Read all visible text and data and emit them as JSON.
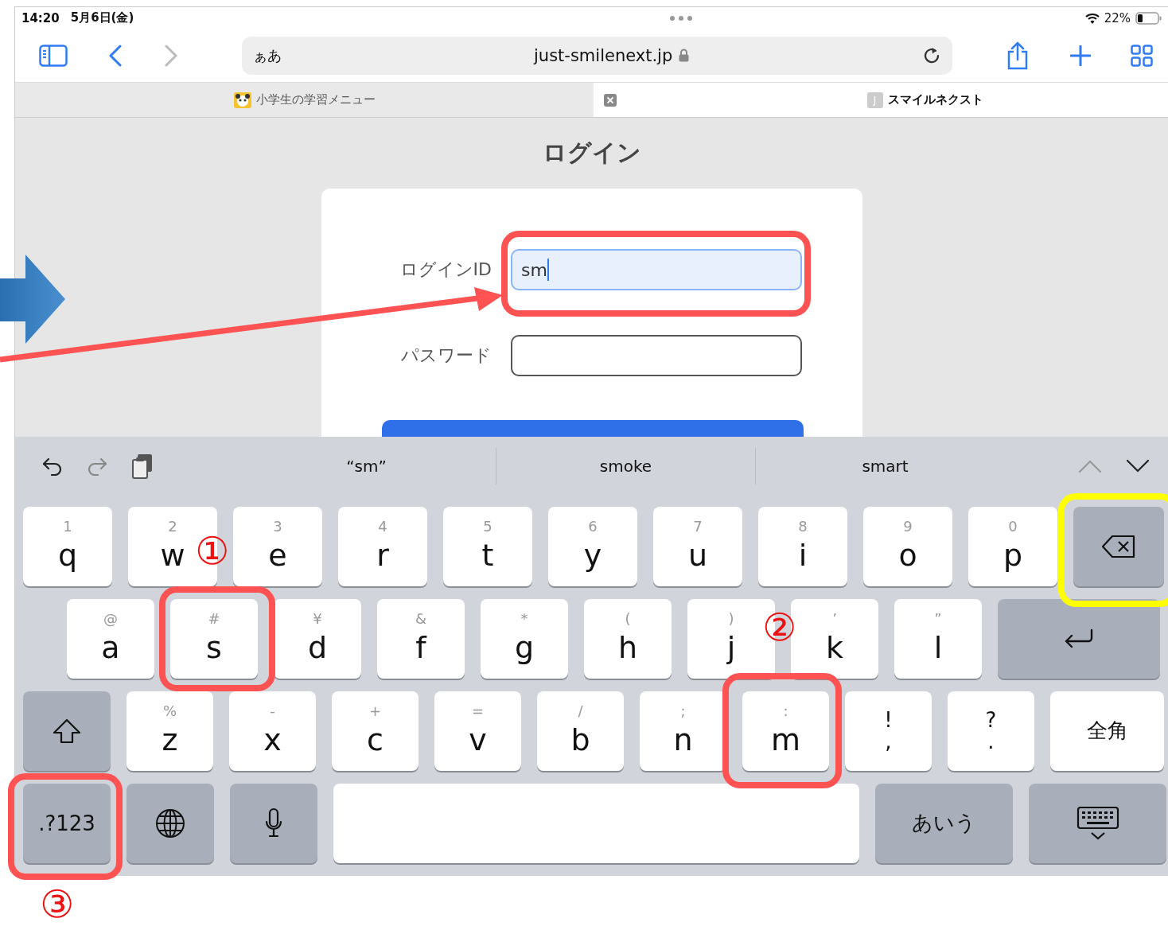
{
  "status_bar": {
    "time": "14:20",
    "date": "5月6日(金)",
    "battery": "22%"
  },
  "browser": {
    "format_button": "ぁあ",
    "url": "just-smilenext.jp",
    "tabs": [
      {
        "title": "小学生の学習メニュー",
        "selected": false
      },
      {
        "title": "スマイルネクスト",
        "favicon_letter": "J",
        "selected": true
      }
    ]
  },
  "page": {
    "heading": "ログイン",
    "fields": [
      {
        "label": "ログインID",
        "value": "sm",
        "focused": true
      },
      {
        "label": "パスワード",
        "focused": false
      }
    ]
  },
  "keyboard": {
    "suggestions": [
      "“sm”",
      "smoke",
      "smart"
    ],
    "rows": [
      [
        {
          "kind": "letter",
          "label": "q",
          "hint": "1"
        },
        {
          "kind": "letter",
          "label": "w",
          "hint": "2"
        },
        {
          "kind": "letter",
          "label": "e",
          "hint": "3"
        },
        {
          "kind": "letter",
          "label": "r",
          "hint": "4"
        },
        {
          "kind": "letter",
          "label": "t",
          "hint": "5"
        },
        {
          "kind": "letter",
          "label": "y",
          "hint": "6"
        },
        {
          "kind": "letter",
          "label": "u",
          "hint": "7"
        },
        {
          "kind": "letter",
          "label": "i",
          "hint": "8"
        },
        {
          "kind": "letter",
          "label": "o",
          "hint": "9"
        },
        {
          "kind": "letter",
          "label": "p",
          "hint": "0"
        },
        {
          "kind": "delete"
        }
      ],
      [
        {
          "kind": "letter",
          "label": "a",
          "hint": "@"
        },
        {
          "kind": "letter",
          "label": "s",
          "hint": "#"
        },
        {
          "kind": "letter",
          "label": "d",
          "hint": "¥"
        },
        {
          "kind": "letter",
          "label": "f",
          "hint": "&"
        },
        {
          "kind": "letter",
          "label": "g",
          "hint": "*"
        },
        {
          "kind": "letter",
          "label": "h",
          "hint": "("
        },
        {
          "kind": "letter",
          "label": "j",
          "hint": ")"
        },
        {
          "kind": "letter",
          "label": "k",
          "hint": "’"
        },
        {
          "kind": "letter",
          "label": "l",
          "hint": "”"
        },
        {
          "kind": "return"
        }
      ],
      [
        {
          "kind": "shift"
        },
        {
          "kind": "letter",
          "label": "z",
          "hint": "%"
        },
        {
          "kind": "letter",
          "label": "x",
          "hint": "-"
        },
        {
          "kind": "letter",
          "label": "c",
          "hint": "+"
        },
        {
          "kind": "letter",
          "label": "v",
          "hint": "="
        },
        {
          "kind": "letter",
          "label": "b",
          "hint": "/"
        },
        {
          "kind": "letter",
          "label": "n",
          "hint": ";"
        },
        {
          "kind": "letter",
          "label": "m",
          "hint": ":"
        },
        {
          "kind": "pair",
          "top": "!",
          "bottom": ","
        },
        {
          "kind": "pair",
          "top": "?",
          "bottom": "."
        },
        {
          "kind": "text",
          "label": "全角"
        }
      ],
      [
        {
          "kind": "mode",
          "label": ".?123"
        },
        {
          "kind": "globe"
        },
        {
          "kind": "mic"
        },
        {
          "kind": "space"
        },
        {
          "kind": "mode",
          "label": "あいう"
        },
        {
          "kind": "hide"
        }
      ]
    ]
  },
  "annotations": {
    "highlights": [
      {
        "color": "#ff5252"
      },
      {
        "color": "#ff5252"
      },
      {
        "color": "#ff5252"
      },
      {
        "color": "#ff5252"
      },
      {
        "color": "#ffff00"
      }
    ],
    "numbers": [
      "①",
      "②",
      "③"
    ]
  }
}
